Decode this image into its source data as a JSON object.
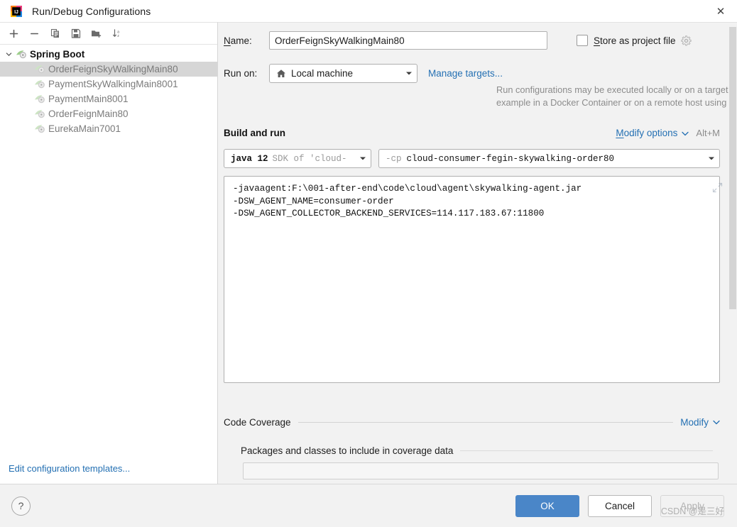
{
  "window": {
    "title": "Run/Debug Configurations",
    "app_icon": "intellij-idea-logo",
    "close_label": "✕"
  },
  "toolbar": {
    "buttons": [
      {
        "name": "add",
        "glyph": "+",
        "tooltip": "Add New Configuration"
      },
      {
        "name": "remove",
        "glyph": "−",
        "tooltip": "Remove Configuration"
      },
      {
        "name": "copy",
        "glyph": "copy-icon",
        "tooltip": "Copy Configuration"
      },
      {
        "name": "save",
        "glyph": "save-icon",
        "tooltip": "Save Configuration"
      },
      {
        "name": "new-folder",
        "glyph": "new-folder-icon",
        "tooltip": "Create New Folder"
      },
      {
        "name": "sort",
        "glyph": "sort-az-icon",
        "tooltip": "Sort Configurations"
      }
    ]
  },
  "sidebar": {
    "group": {
      "label": "Spring Boot",
      "expanded": true,
      "icon": "spring-boot-icon"
    },
    "items": [
      {
        "label": "OrderFeignSkyWalkingMain80",
        "selected": true,
        "icon": "spring-boot-icon"
      },
      {
        "label": "PaymentSkyWalkingMain8001",
        "selected": false,
        "icon": "spring-boot-icon"
      },
      {
        "label": "PaymentMain8001",
        "selected": false,
        "icon": "spring-boot-icon"
      },
      {
        "label": "OrderFeignMain80",
        "selected": false,
        "icon": "spring-boot-icon"
      },
      {
        "label": "EurekaMain7001",
        "selected": false,
        "icon": "spring-boot-icon"
      }
    ],
    "edit_templates_link": "Edit configuration templates..."
  },
  "form": {
    "name_label": "Name:",
    "name_value": "OrderFeignSkyWalkingMain80",
    "store_as_project_file_label": "Store as project file",
    "store_as_project_file_checked": false,
    "store_gear_icon": "gear-icon",
    "run_on_label": "Run on:",
    "run_on_value": "Local machine",
    "run_on_icon": "home-icon",
    "manage_targets_link": "Manage targets...",
    "hint_line1": "Run configurations may be executed locally or on a target: for",
    "hint_line2": "example in a Docker Container or on a remote host using SSH."
  },
  "build_and_run": {
    "section_title": "Build and run",
    "modify_options_link": "Modify options",
    "modify_options_shortcut": "Alt+M",
    "jdk_main": "java 12",
    "jdk_sub": "SDK of 'cloud-",
    "classpath_flag": "-cp",
    "classpath_value": "cloud-consumer-fegin-skywalking-order80",
    "vm_options": "-javaagent:F:\\001-after-end\\code\\cloud\\agent\\skywalking-agent.jar\n-DSW_AGENT_NAME=consumer-order\n-DSW_AGENT_COLLECTOR_BACKEND_SERVICES=114.117.183.67:11800",
    "expand_icon": "expand-arrows-icon"
  },
  "code_coverage": {
    "section_title": "Code Coverage",
    "modify_link": "Modify",
    "sub_title": "Packages and classes to include in coverage data",
    "field_value": ""
  },
  "footer": {
    "help_label": "?",
    "ok_label": "OK",
    "cancel_label": "Cancel",
    "apply_label": "Apply",
    "apply_disabled": true
  },
  "watermark": "CSDN @是三好",
  "colors": {
    "accent_blue": "#4a86c8",
    "link_blue": "#2470b3",
    "selection_gray": "#d6d6d6",
    "panel_bg": "#f2f2f2"
  }
}
